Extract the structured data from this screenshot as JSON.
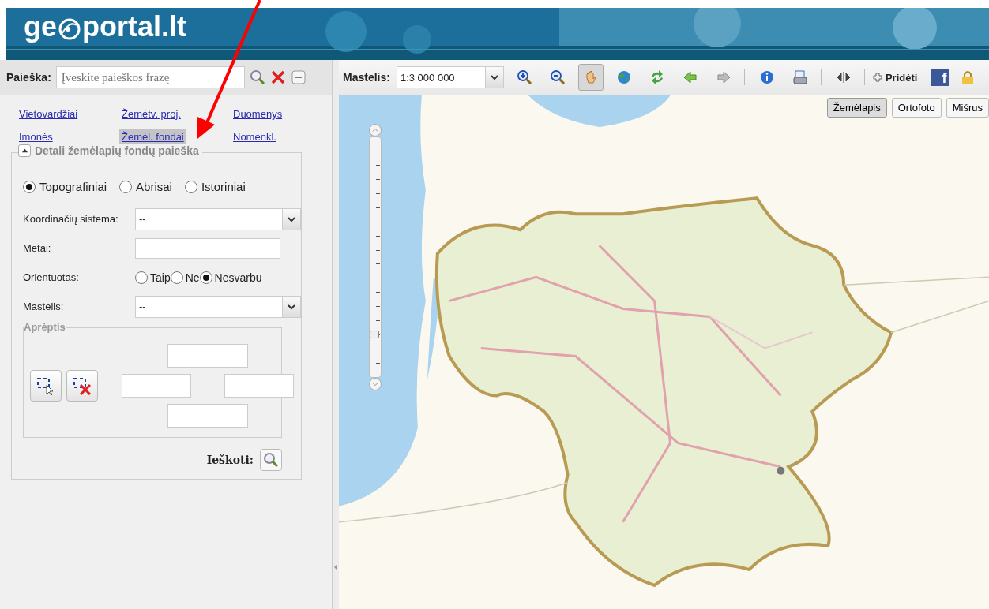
{
  "logo": {
    "before": "ge",
    "after": "portal.lt"
  },
  "search": {
    "label": "Paieška:",
    "placeholder": "Įveskite paieškos frazę"
  },
  "categories": [
    {
      "label": "Vietovardžiai",
      "selected": false
    },
    {
      "label": "Žemėtv. proj.",
      "selected": false
    },
    {
      "label": "Duomenys",
      "selected": false
    },
    {
      "label": "Imonės",
      "selected": false
    },
    {
      "label": "Žemėl. fondai",
      "selected": true
    },
    {
      "label": "Nomenkl.",
      "selected": false
    }
  ],
  "panel": {
    "title": "Detali žemėlapių fondų paieška",
    "expanded": true,
    "types": [
      {
        "label": "Topografiniai",
        "selected": true
      },
      {
        "label": "Abrisai",
        "selected": false
      },
      {
        "label": "Istoriniai",
        "selected": false
      }
    ],
    "fields": [
      {
        "kind": "select",
        "label": "Koordinačių sistema:",
        "value": "--"
      },
      {
        "kind": "text",
        "label": "Metai:"
      },
      {
        "kind": "radio",
        "label": "Orientuotas:",
        "options": [
          {
            "label": "Taip",
            "selected": false
          },
          {
            "label": "Ne",
            "selected": false
          },
          {
            "label": "Nesvarbu",
            "selected": true
          }
        ]
      },
      {
        "kind": "select",
        "label": "Mastelis:",
        "value": "--"
      }
    ],
    "extent": {
      "title": "Aprėptis"
    },
    "search_button": {
      "label": "Ieškoti:"
    }
  },
  "toolbar": {
    "scale_label": "Mastelis:",
    "scale_value": "1:3 000 000",
    "groups": [
      [
        {
          "kind": "zoom-in",
          "selected": false
        },
        {
          "kind": "zoom-out",
          "selected": false
        },
        {
          "kind": "pan",
          "selected": true
        },
        {
          "kind": "globe",
          "selected": false
        },
        {
          "kind": "refresh",
          "selected": false
        },
        {
          "kind": "back",
          "selected": false
        },
        {
          "kind": "forward",
          "selected": false
        }
      ],
      [
        {
          "kind": "info",
          "selected": false
        },
        {
          "kind": "print",
          "selected": false
        }
      ],
      [
        {
          "kind": "split",
          "selected": false
        }
      ]
    ],
    "add_label": "Pridėti",
    "facebook": "f"
  },
  "map": {
    "zoom": {
      "level": 0.16
    },
    "layers": [
      {
        "label": "Žemėlapis",
        "selected": true
      },
      {
        "label": "Ortofoto",
        "selected": false
      },
      {
        "label": "Mišrus",
        "selected": false
      }
    ]
  }
}
